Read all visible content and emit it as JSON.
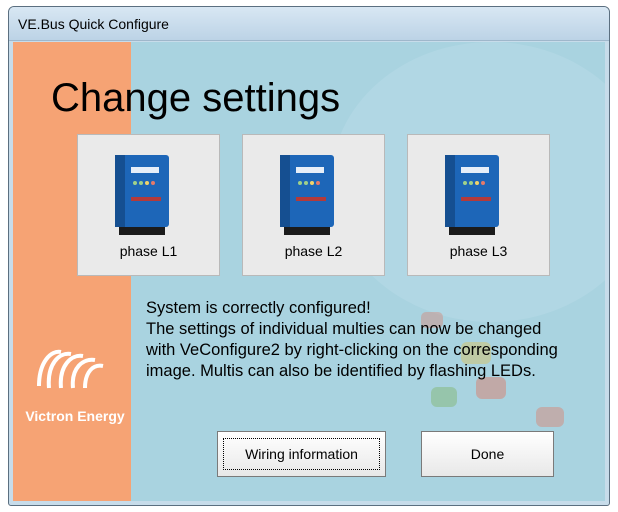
{
  "window": {
    "title": "VE.Bus Quick Configure"
  },
  "brand": {
    "name": "Victron Energy",
    "strip_color": "#f6a374"
  },
  "heading": "Change settings",
  "phases": [
    {
      "label": "phase L1"
    },
    {
      "label": "phase L2"
    },
    {
      "label": "phase L3"
    }
  ],
  "status": {
    "line1": "System is correctly configured!",
    "line2": "The settings of individual multies can now be changed with VeConfigure2 by right-clicking on the corresponding image. Multis can also be identified by flashing LEDs."
  },
  "buttons": {
    "wiring": "Wiring information",
    "done": "Done"
  },
  "colors": {
    "client_bg": "#a9d3e0",
    "device_blue": "#1d66b8"
  },
  "icons": {
    "device": "multiplus-inverter-icon",
    "logo": "victron-spiral-logo"
  }
}
